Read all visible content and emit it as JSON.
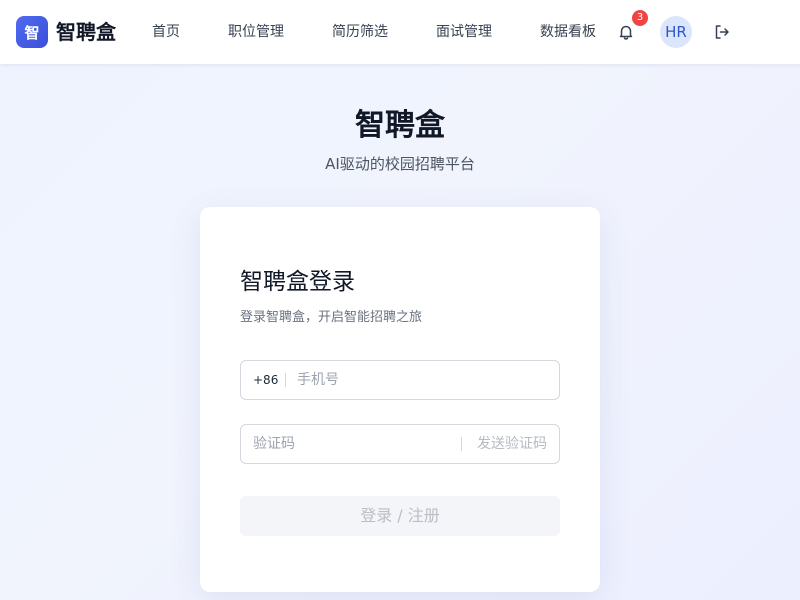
{
  "header": {
    "logo_text": "智",
    "brand": "智聘盒",
    "nav": [
      {
        "label": "首页"
      },
      {
        "label": "职位管理"
      },
      {
        "label": "简历筛选"
      },
      {
        "label": "面试管理"
      },
      {
        "label": "数据看板"
      }
    ],
    "notifications": {
      "icon": "bell-icon",
      "count": "3"
    },
    "avatar_text": "HR",
    "logout_icon": "logout-icon"
  },
  "hero": {
    "title": "智聘盒",
    "subtitle": "AI驱动的校园招聘平台"
  },
  "login": {
    "title": "智聘盒登录",
    "subtitle": "登录智聘盒，开启智能招聘之旅",
    "phone_prefix": "+86",
    "phone_placeholder": "手机号",
    "code_placeholder": "验证码",
    "send_code": "发送验证码",
    "submit": "登录 / 注册"
  },
  "colors": {
    "accent": "#3b4fd8",
    "badge": "#ef4444",
    "avatar_bg": "#dbe6fd"
  }
}
